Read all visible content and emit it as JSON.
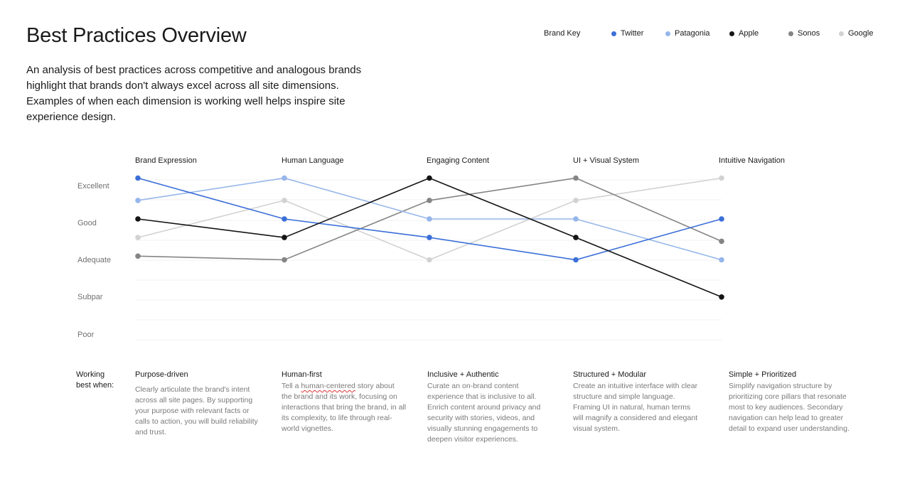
{
  "page": {
    "title": "Best Practices Overview",
    "intro": "An analysis of best practices across competitive and analogous brands highlight that brands don't always excel across all site dimensions. Examples of when each dimension is working well helps inspire site experience design."
  },
  "legend": {
    "title": "Brand Key",
    "items": [
      {
        "name": "Twitter",
        "color": "#3b6fd8"
      },
      {
        "name": "Patagonia",
        "color": "#95b6ea"
      },
      {
        "name": "Apple",
        "color": "#141414"
      },
      {
        "name": "Sonos",
        "color": "#858585"
      },
      {
        "name": "Google",
        "color": "#d2d2d2"
      }
    ]
  },
  "chart_data": {
    "type": "line",
    "categories": [
      "Brand Expression",
      "Human Language",
      "Engaging Content",
      "UI + Visual System",
      "Intuitive Navigation"
    ],
    "y_levels": [
      "Excellent",
      "Good",
      "Adequate",
      "Subpar",
      "Poor"
    ],
    "y_scale": "Poor = 1, Subpar = 2, Adequate = 3, Good = 4, Excellent = 5",
    "ylim": [
      1,
      5
    ],
    "grid": true,
    "legend_position": "top-right",
    "series": [
      {
        "name": "Twitter",
        "color": "#3b6fd8",
        "values": [
          5.2,
          4.1,
          3.6,
          3.0,
          4.1
        ]
      },
      {
        "name": "Patagonia",
        "color": "#95b6ea",
        "values": [
          4.6,
          5.2,
          4.1,
          4.1,
          3.0
        ]
      },
      {
        "name": "Apple",
        "color": "#141414",
        "values": [
          4.1,
          3.6,
          5.2,
          3.6,
          2.0
        ]
      },
      {
        "name": "Sonos",
        "color": "#858585",
        "values": [
          3.1,
          3.0,
          4.6,
          5.2,
          3.5
        ]
      },
      {
        "name": "Google",
        "color": "#d2d2d2",
        "values": [
          3.6,
          4.6,
          3.0,
          4.6,
          5.2
        ]
      }
    ]
  },
  "working": {
    "label_line1": "Working",
    "label_line2": "best when:",
    "columns": [
      {
        "title": "Purpose-driven",
        "text": "Clearly articulate the brand's intent across all site pages. By supporting your purpose with relevant facts or calls to action, you will build reliability and trust."
      },
      {
        "title": "Human-first",
        "text_pre": "Tell a ",
        "text_flag": "human-centered",
        "text_post": " story about the brand and its work, focusing on interactions that bring the brand, in all its complexity, to life through real-world vignettes."
      },
      {
        "title": "Inclusive + Authentic",
        "text": "Curate an on-brand content experience that is inclusive to all. Enrich content around privacy and security with stories, videos, and visually stunning engagements to deepen visitor experiences."
      },
      {
        "title": "Structured + Modular",
        "text": "Create an intuitive interface with clear structure and simple language. Framing UI in natural, human terms will magnify a considered and elegant visual system."
      },
      {
        "title": "Simple + Prioritized",
        "text": "Simplify navigation structure by prioritizing core pillars that resonate most to key audiences. Secondary navigation can help lead to greater detail to expand user understanding."
      }
    ]
  }
}
